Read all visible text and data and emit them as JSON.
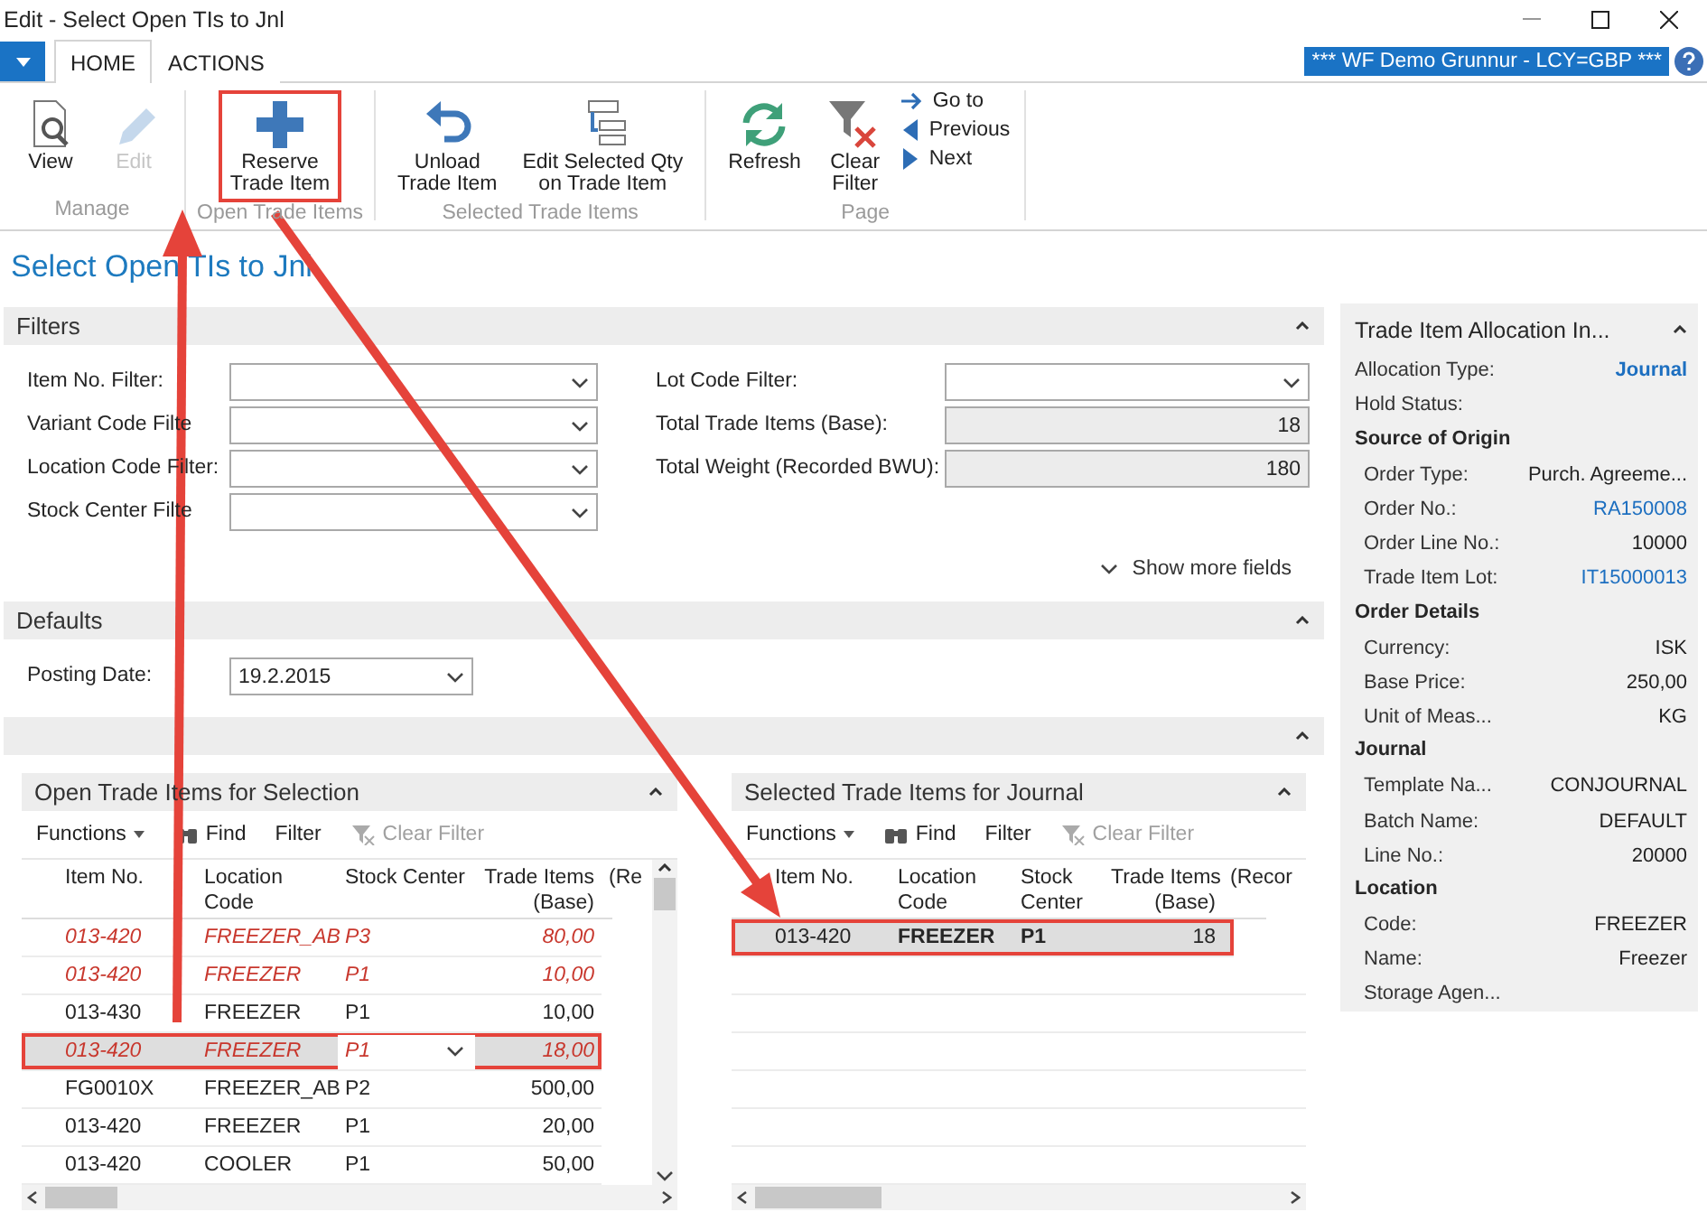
{
  "window": {
    "title": "Edit - Select Open TIs to Jnl"
  },
  "ribbon": {
    "tabs": [
      {
        "label": "HOME",
        "selected": true
      },
      {
        "label": "ACTIONS",
        "selected": false
      }
    ],
    "company": "*** WF Demo Grunnur - LCY=GBP ***",
    "groups": [
      {
        "label": "Manage",
        "buttons": [
          {
            "label": "View",
            "kind": "large",
            "disabled": false,
            "annotated": false
          },
          {
            "label": "Edit",
            "kind": "large",
            "disabled": true,
            "annotated": false
          }
        ]
      },
      {
        "label": "Open Trade Items",
        "buttons": [
          {
            "label": "Reserve\nTrade Item",
            "kind": "large",
            "disabled": false,
            "annotated": true
          }
        ]
      },
      {
        "label": "Selected Trade Items",
        "buttons": [
          {
            "label": "Unload\nTrade Item",
            "kind": "large",
            "disabled": false,
            "annotated": false
          },
          {
            "label": "Edit Selected Qty\non Trade Item",
            "kind": "large",
            "disabled": false,
            "annotated": false
          }
        ]
      },
      {
        "label": "Page",
        "buttons": [
          {
            "label": "Refresh",
            "kind": "large",
            "disabled": false,
            "annotated": false
          },
          {
            "label": "Clear\nFilter",
            "kind": "large",
            "disabled": false,
            "annotated": false
          },
          {
            "label": "Go to",
            "kind": "small",
            "disabled": false,
            "annotated": false
          },
          {
            "label": "Previous",
            "kind": "small",
            "disabled": false,
            "annotated": false
          },
          {
            "label": "Next",
            "kind": "small",
            "disabled": false,
            "annotated": false
          }
        ]
      }
    ]
  },
  "page_title": "Select Open TIs to Jnl",
  "filters": {
    "title": "Filters",
    "left": [
      {
        "label": "Item No. Filter:",
        "kind": "dropdown"
      },
      {
        "label": "Variant Code Filte",
        "kind": "dropdown"
      },
      {
        "label": "Location Code Filter:",
        "kind": "dropdown"
      },
      {
        "label": "Stock Center Filte",
        "kind": "dropdown"
      }
    ],
    "right": [
      {
        "label": "Lot Code Filter:",
        "kind": "dropdown"
      },
      {
        "label": "Total Trade Items (Base):",
        "kind": "readonly",
        "value": "18"
      },
      {
        "label": "Total Weight (Recorded BWU):",
        "kind": "readonly",
        "value": "180"
      }
    ],
    "show_more": "Show more fields"
  },
  "defaults": {
    "title": "Defaults",
    "fields": [
      {
        "label": "Posting Date:",
        "kind": "dropdown",
        "value": "19.2.2015"
      }
    ]
  },
  "parts": [
    {
      "title": "Open Trade Items for Selection",
      "toolbar": [
        {
          "label": "Functions",
          "kind": "menu",
          "disabled": false
        },
        {
          "label": "Find",
          "kind": "find",
          "disabled": false
        },
        {
          "label": "Filter",
          "kind": "plain",
          "disabled": false
        },
        {
          "label": "Clear Filter",
          "kind": "clearfilter",
          "disabled": true
        }
      ],
      "columns": [
        "Item No.",
        "Location\nCode",
        "Stock Center",
        "Trade Items\n(Base)",
        "(Re"
      ],
      "rows": [
        {
          "cells": [
            "013-420",
            "FREEZER_AB",
            "P3",
            "80,00"
          ],
          "reserved": true,
          "selected": false,
          "annotated": false
        },
        {
          "cells": [
            "013-420",
            "FREEZER",
            "P1",
            "10,00"
          ],
          "reserved": true,
          "selected": false,
          "annotated": false
        },
        {
          "cells": [
            "013-430",
            "FREEZER",
            "P1",
            "10,00"
          ],
          "reserved": false,
          "selected": false,
          "annotated": false
        },
        {
          "cells": [
            "013-420",
            "FREEZER",
            "P1",
            "18,00"
          ],
          "reserved": true,
          "selected": true,
          "annotated": true
        },
        {
          "cells": [
            "FG0010X",
            "FREEZER_AB",
            "P2",
            "500,00"
          ],
          "reserved": false,
          "selected": false,
          "annotated": false
        },
        {
          "cells": [
            "013-420",
            "FREEZER",
            "P1",
            "20,00"
          ],
          "reserved": false,
          "selected": false,
          "annotated": false
        },
        {
          "cells": [
            "013-420",
            "COOLER",
            "P1",
            "50,00"
          ],
          "reserved": false,
          "selected": false,
          "annotated": false
        }
      ]
    },
    {
      "title": "Selected Trade Items for Journal",
      "toolbar": [
        {
          "label": "Functions",
          "kind": "menu",
          "disabled": false
        },
        {
          "label": "Find",
          "kind": "find",
          "disabled": false
        },
        {
          "label": "Filter",
          "kind": "plain",
          "disabled": false
        },
        {
          "label": "Clear Filter",
          "kind": "clearfilter",
          "disabled": true
        }
      ],
      "columns": [
        "Item No.",
        "Location\nCode",
        "Stock\nCenter",
        "Trade Items\n(Base)",
        "(Recor"
      ],
      "rows": [
        {
          "cells": [
            "013-420",
            "FREEZER",
            "P1",
            "18"
          ],
          "reserved": false,
          "selected": true,
          "annotated": true
        }
      ]
    }
  ],
  "factbox": {
    "title": "Trade Item Allocation In...",
    "items": [
      {
        "kind": "field",
        "label": "Allocation Type:",
        "value": "Journal",
        "link": true
      },
      {
        "kind": "field",
        "label": "Hold Status:"
      },
      {
        "kind": "group",
        "label": "Source of Origin",
        "children": [
          {
            "kind": "field",
            "label": "Order Type:",
            "value": "Purch. Agreeme...",
            "link": false
          },
          {
            "kind": "field",
            "label": "Order No.:",
            "value": "RA150008",
            "link": true
          },
          {
            "kind": "field",
            "label": "Order Line No.:",
            "value": "10000",
            "link": false
          },
          {
            "kind": "field",
            "label": "Trade Item Lot:",
            "value": "IT15000013",
            "link": true
          }
        ]
      },
      {
        "kind": "group",
        "label": "Order Details",
        "children": [
          {
            "kind": "field",
            "label": "Currency:",
            "value": "ISK",
            "link": false
          },
          {
            "kind": "field",
            "label": "Base Price:",
            "value": "250,00",
            "link": false
          },
          {
            "kind": "field",
            "label": "Unit of Meas...",
            "value": "KG",
            "link": false
          }
        ]
      },
      {
        "kind": "group",
        "label": "Journal",
        "children": [
          {
            "kind": "field",
            "label": "Template Na...",
            "value": "CONJOURNAL",
            "link": false
          },
          {
            "kind": "field",
            "label": "Batch Name:",
            "value": "DEFAULT",
            "link": false
          },
          {
            "kind": "field",
            "label": "Line No.:",
            "value": "20000",
            "link": false
          }
        ]
      },
      {
        "kind": "group",
        "label": "Location",
        "children": [
          {
            "kind": "field",
            "label": "Code:",
            "value": "FREEZER",
            "link": false
          },
          {
            "kind": "field",
            "label": "Name:",
            "value": "Freezer",
            "link": false
          },
          {
            "kind": "field",
            "label": "Storage Agen..."
          }
        ]
      }
    ]
  }
}
